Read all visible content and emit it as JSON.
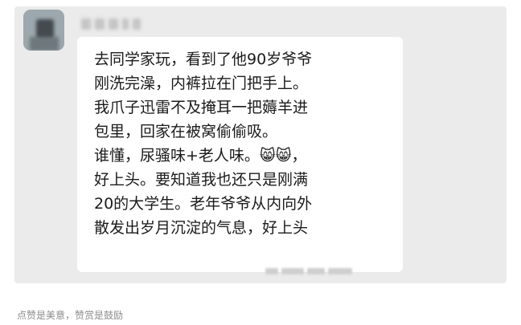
{
  "message": {
    "lines": [
      "去同学家玩，看到了他90岁爷爷",
      "刚洗完澡，内裤拉在门把手上。",
      "我爪子迅雷不及掩耳一把薅羊进",
      "包里，回家在被窝偷偷吸。",
      "谁懂，尿骚味+老人味。😸😸，",
      "好上头。要知道我也还只是刚满",
      "20的大学生。老年爷爷从内向外",
      "散发出岁月沉淀的气息，好上头"
    ]
  },
  "footer": {
    "caption": "点赞是美意，赞赏是鼓励"
  }
}
